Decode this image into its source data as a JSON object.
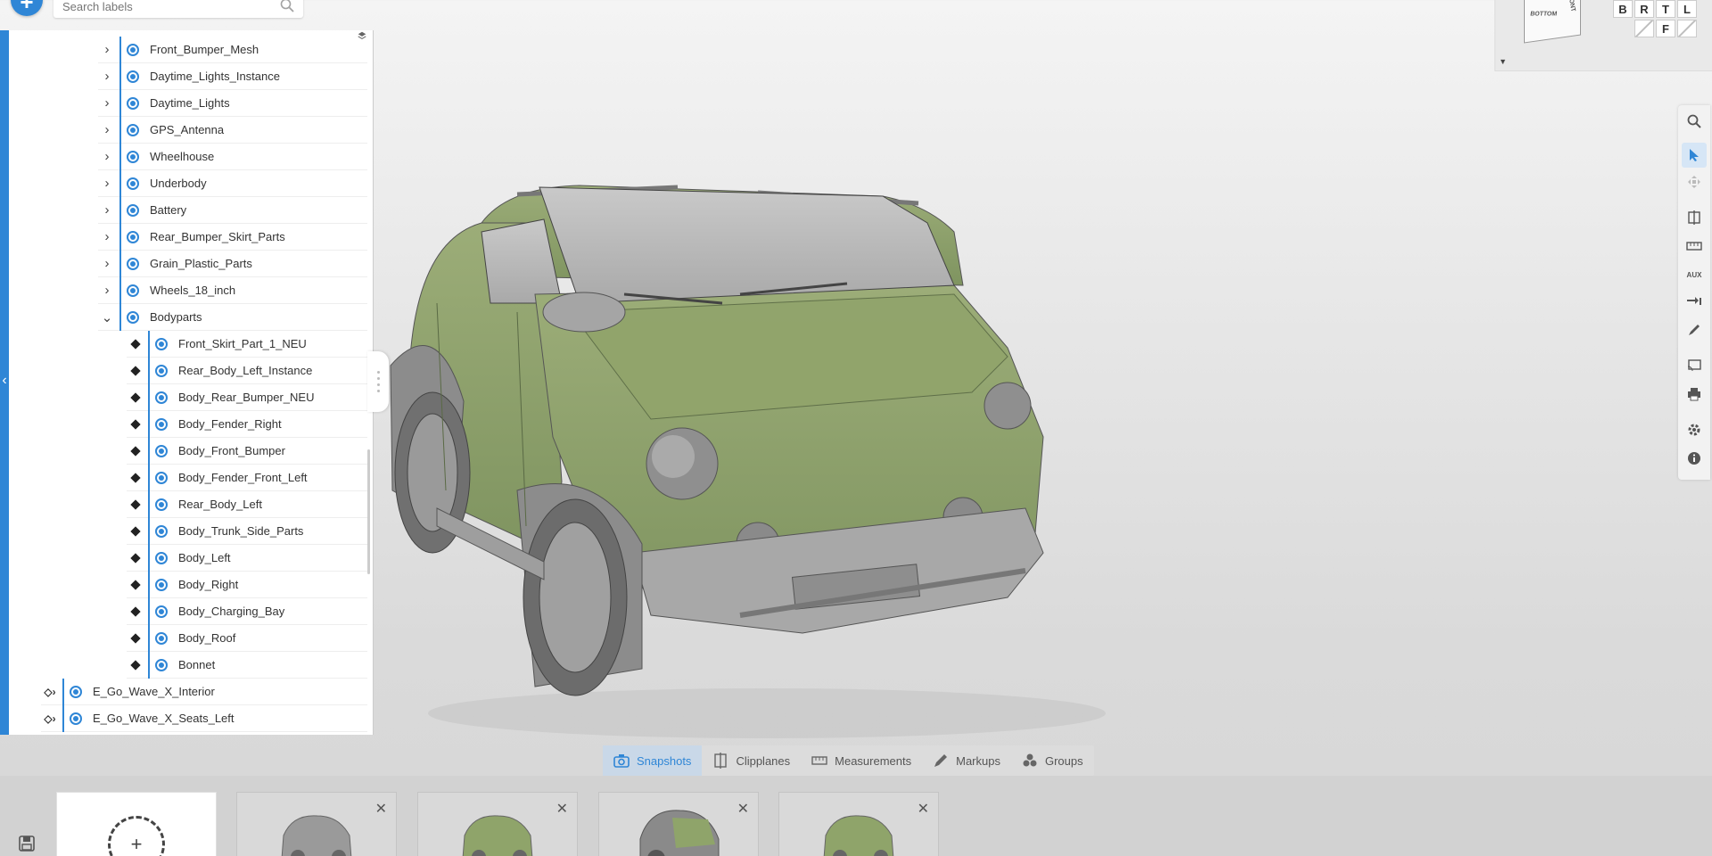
{
  "search": {
    "placeholder": "Search labels"
  },
  "tree": {
    "level1": [
      {
        "label": "Front_Bumper_Mesh",
        "expanded": false
      },
      {
        "label": "Daytime_Lights_Instance",
        "expanded": false
      },
      {
        "label": "Daytime_Lights",
        "expanded": false
      },
      {
        "label": "GPS_Antenna",
        "expanded": false
      },
      {
        "label": "Wheelhouse",
        "expanded": false
      },
      {
        "label": "Underbody",
        "expanded": false
      },
      {
        "label": "Battery",
        "expanded": false
      },
      {
        "label": "Rear_Bumper_Skirt_Parts",
        "expanded": false
      },
      {
        "label": "Grain_Plastic_Parts",
        "expanded": false
      },
      {
        "label": "Wheels_18_inch",
        "expanded": false
      },
      {
        "label": "Bodyparts",
        "expanded": true
      }
    ],
    "bodyparts": [
      "Front_Skirt_Part_1_NEU",
      "Rear_Body_Left_Instance",
      "Body_Rear_Bumper_NEU",
      "Body_Fender_Right",
      "Body_Front_Bumper",
      "Body_Fender_Front_Left",
      "Rear_Body_Left",
      "Body_Trunk_Side_Parts",
      "Body_Left",
      "Body_Right",
      "Body_Charging_Bay",
      "Body_Roof",
      "Bonnet"
    ],
    "level0": [
      "E_Go_Wave_X_Interior",
      "E_Go_Wave_X_Seats_Left"
    ]
  },
  "nav_cube": {
    "face_bottom": "BOTTOM",
    "face_front": "FRONT",
    "views": [
      "B",
      "R",
      "T",
      "L",
      "",
      "",
      "F",
      ""
    ]
  },
  "tools": [
    "search-icon",
    "select-icon",
    "transform-icon",
    "clipplane-icon",
    "measure-icon",
    "aux-icon",
    "explode-icon",
    "markup-icon",
    "cast-icon",
    "print-icon",
    "settings-icon",
    "info-icon"
  ],
  "tool_aux_label": "AUX",
  "tabs": {
    "snapshots": "Snapshots",
    "clipplanes": "Clipplanes",
    "measurements": "Measurements",
    "markups": "Markups",
    "groups": "Groups"
  },
  "snapshots": {
    "new_label": "+",
    "close": "✕"
  },
  "colors": {
    "accent": "#2f86d6",
    "car_body": "#8fa46a",
    "car_gray": "#9a9a9a"
  }
}
